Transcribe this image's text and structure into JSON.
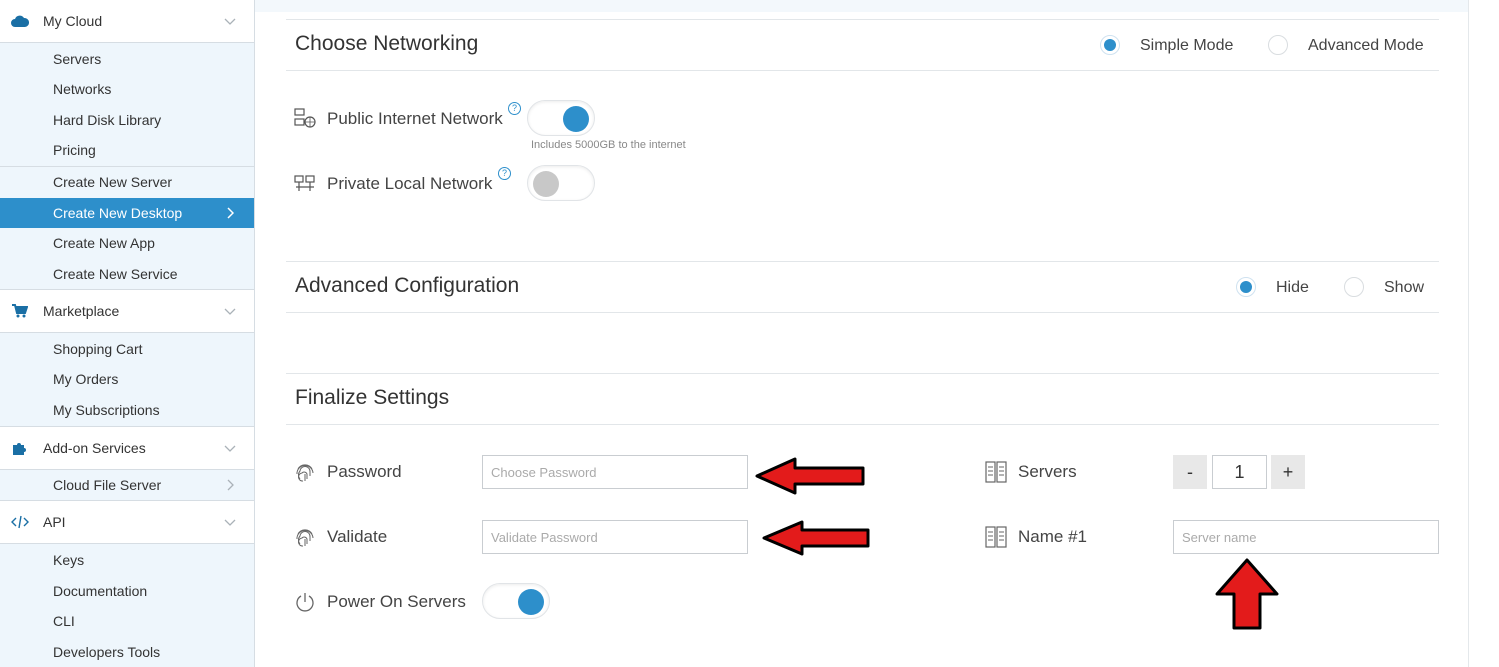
{
  "sidebar": {
    "my_cloud": {
      "label": "My Cloud",
      "icon": "cloud-icon"
    },
    "my_cloud_items": [
      {
        "label": "Servers"
      },
      {
        "label": "Networks"
      },
      {
        "label": "Hard Disk Library"
      },
      {
        "label": "Pricing"
      }
    ],
    "create_items": [
      {
        "label": "Create New Server"
      },
      {
        "label": "Create New Desktop",
        "active": true
      },
      {
        "label": "Create New App"
      },
      {
        "label": "Create New Service"
      }
    ],
    "marketplace": {
      "label": "Marketplace",
      "icon": "cart-icon"
    },
    "marketplace_items": [
      {
        "label": "Shopping Cart"
      },
      {
        "label": "My Orders"
      },
      {
        "label": "My Subscriptions"
      }
    ],
    "addons": {
      "label": "Add-on Services",
      "icon": "puzzle-icon"
    },
    "addons_items": [
      {
        "label": "Cloud File Server"
      }
    ],
    "api": {
      "label": "API",
      "icon": "code-icon"
    },
    "api_items": [
      {
        "label": "Keys"
      },
      {
        "label": "Documentation"
      },
      {
        "label": "CLI"
      },
      {
        "label": "Developers Tools"
      }
    ]
  },
  "networking": {
    "title": "Choose Networking",
    "mode_simple": "Simple Mode",
    "mode_advanced": "Advanced Mode",
    "selected_mode": "Simple Mode",
    "public_label": "Public Internet Network",
    "public_enabled": true,
    "public_hint": "Includes 5000GB to the internet",
    "private_label": "Private Local Network",
    "private_enabled": false,
    "help_glyph": "?"
  },
  "advanced": {
    "title": "Advanced Configuration",
    "hide_label": "Hide",
    "show_label": "Show",
    "selected": "Hide"
  },
  "finalize": {
    "title": "Finalize Settings",
    "password_label": "Password",
    "password_placeholder": "Choose Password",
    "validate_label": "Validate",
    "validate_placeholder": "Validate Password",
    "power_label": "Power On Servers",
    "power_enabled": true,
    "servers_label": "Servers",
    "servers_count": "1",
    "minus": "-",
    "plus": "+",
    "name_label": "Name #1",
    "name_placeholder": "Server name"
  },
  "colors": {
    "accent": "#2d8fcb",
    "arrow": "#e31b1b",
    "sidebar_bg": "#eef6fc"
  }
}
